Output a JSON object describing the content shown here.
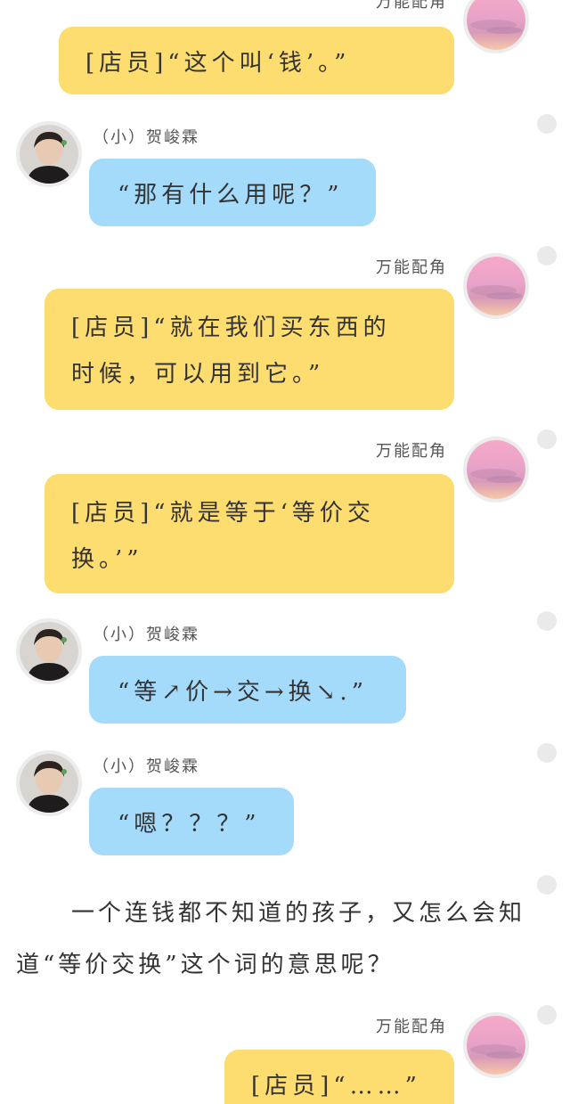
{
  "messages": [
    {
      "speaker": "万能配角",
      "lines": [
        "[店员]“这个叫‘钱’。”"
      ]
    },
    {
      "speaker": "（小）贺峻霖",
      "lines": [
        "“那有什么用呢？”"
      ]
    },
    {
      "speaker": "万能配角",
      "lines": [
        "[店员]“就在我们买东西的",
        "时候，可以用到它。”"
      ]
    },
    {
      "speaker": "万能配角",
      "lines": [
        "[店员]“就是等于‘等价交",
        "换。’”"
      ]
    },
    {
      "speaker": "（小）贺峻霖",
      "lines": [
        "“等↗价→交→换↘.”"
      ]
    },
    {
      "speaker": "（小）贺峻霖",
      "lines": [
        "“嗯？？？”"
      ]
    },
    {
      "speaker": "万能配角",
      "lines": [
        "[店员]“……”"
      ]
    }
  ],
  "narration": {
    "lines": [
      "一个连钱都不知道的孩子，又怎么会知",
      "道“等价交换”这个词的意思呢？"
    ]
  },
  "colors": {
    "yellow_bubble": "#fddc70",
    "blue_bubble": "#a4dafa",
    "avatar_border": "#ececec",
    "dot": "#eaeaea"
  },
  "icons": {
    "sidekick_avatar": "pink-sunset-avatar",
    "boy_avatar": "boy-portrait-avatar",
    "side_dot": "gray-dot-icon"
  }
}
